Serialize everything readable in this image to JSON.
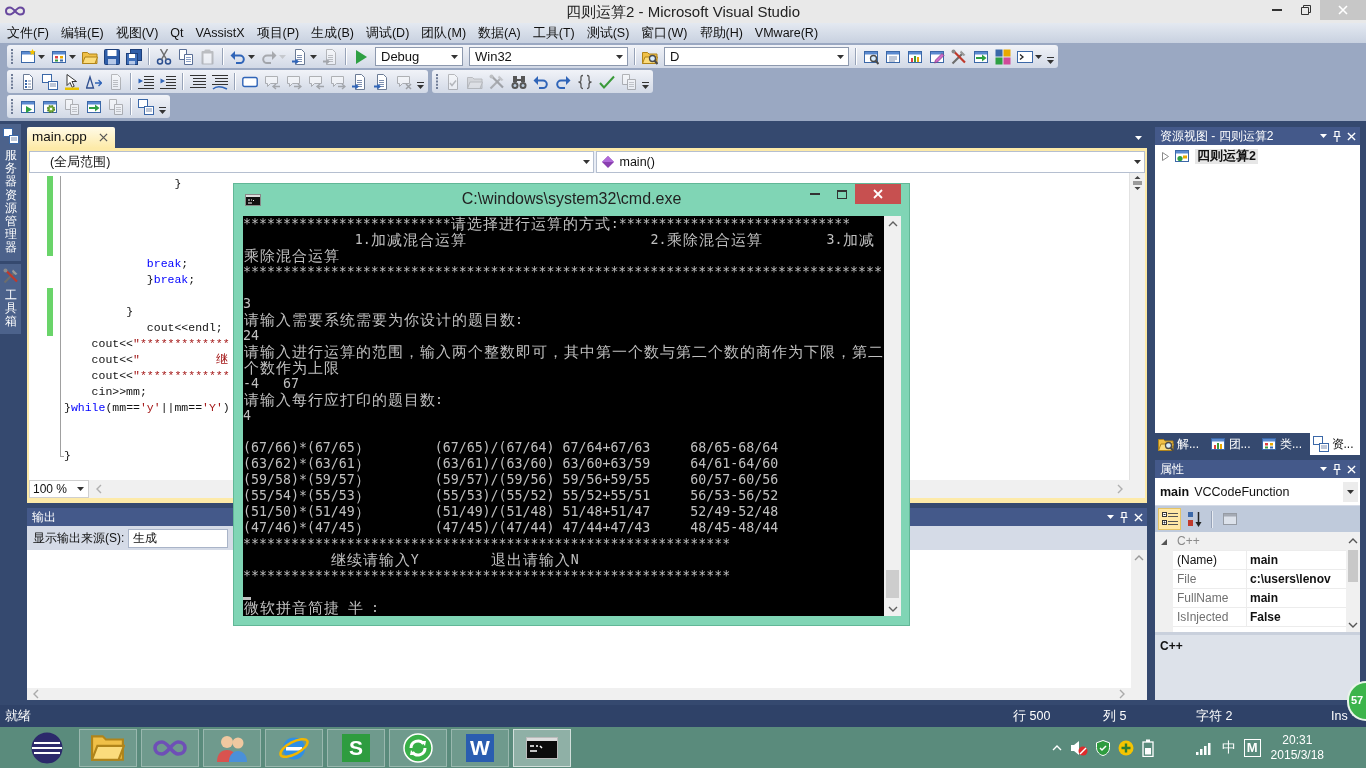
{
  "window": {
    "title": "四则运算2 - Microsoft Visual Studio"
  },
  "menu": [
    "文件(F)",
    "编辑(E)",
    "视图(V)",
    "Qt",
    "VAssistX",
    "项目(P)",
    "生成(B)",
    "调试(D)",
    "团队(M)",
    "数据(A)",
    "工具(T)",
    "测试(S)",
    "窗口(W)",
    "帮助(H)",
    "VMware(R)"
  ],
  "toolbar_rows": [
    {
      "toolbars": [
        {
          "items": [
            {
              "kind": "split",
              "disabled": false
            },
            {
              "kind": "split",
              "disabled": false
            },
            {
              "kind": "button",
              "disabled": false
            },
            {
              "kind": "button",
              "disabled": false
            },
            {
              "kind": "button",
              "disabled": false
            },
            {
              "kind": "separator"
            },
            {
              "kind": "button",
              "disabled": false
            },
            {
              "kind": "button",
              "disabled": false
            },
            {
              "kind": "button",
              "disabled": true
            },
            {
              "kind": "separator"
            },
            {
              "kind": "split",
              "disabled": false
            },
            {
              "kind": "split",
              "disabled": true
            },
            {
              "kind": "split",
              "disabled": false
            },
            {
              "kind": "button",
              "disabled": true
            },
            {
              "kind": "separator"
            },
            {
              "kind": "button",
              "disabled": false
            },
            {
              "kind": "combo",
              "value": "Debug"
            },
            {
              "kind": "combo",
              "value": "Win32"
            },
            {
              "kind": "separator"
            },
            {
              "kind": "button",
              "disabled": false
            },
            {
              "kind": "combo",
              "value": "D"
            },
            {
              "kind": "separator"
            },
            {
              "kind": "button",
              "disabled": false
            },
            {
              "kind": "button",
              "disabled": false
            },
            {
              "kind": "button",
              "disabled": false
            },
            {
              "kind": "button",
              "disabled": false
            },
            {
              "kind": "button",
              "disabled": false
            },
            {
              "kind": "button",
              "disabled": false
            },
            {
              "kind": "button",
              "disabled": false
            },
            {
              "kind": "split",
              "disabled": false
            },
            {
              "kind": "overflow"
            }
          ]
        }
      ]
    },
    {
      "toolbars": [
        {
          "items": [
            {
              "kind": "button",
              "disabled": false
            },
            {
              "kind": "button",
              "disabled": false
            },
            {
              "kind": "button",
              "disabled": false
            },
            {
              "kind": "button",
              "disabled": false
            },
            {
              "kind": "button",
              "disabled": true
            },
            {
              "kind": "separator"
            },
            {
              "kind": "button",
              "disabled": false
            },
            {
              "kind": "button",
              "disabled": false
            },
            {
              "kind": "separator"
            },
            {
              "kind": "button",
              "disabled": false
            },
            {
              "kind": "button",
              "disabled": false
            },
            {
              "kind": "separator"
            },
            {
              "kind": "button",
              "disabled": false
            },
            {
              "kind": "button",
              "disabled": true
            },
            {
              "kind": "button",
              "disabled": true
            },
            {
              "kind": "button",
              "disabled": true
            },
            {
              "kind": "button",
              "disabled": true
            },
            {
              "kind": "button",
              "disabled": false
            },
            {
              "kind": "button",
              "disabled": false
            },
            {
              "kind": "button",
              "disabled": true
            },
            {
              "kind": "overflow"
            }
          ]
        },
        {
          "items": [
            {
              "kind": "button",
              "disabled": true
            },
            {
              "kind": "button",
              "disabled": true
            },
            {
              "kind": "button",
              "disabled": true
            },
            {
              "kind": "button",
              "disabled": false
            },
            {
              "kind": "button",
              "disabled": false
            },
            {
              "kind": "button",
              "disabled": false
            },
            {
              "kind": "button",
              "disabled": false
            },
            {
              "kind": "button",
              "disabled": false
            },
            {
              "kind": "button",
              "disabled": true
            },
            {
              "kind": "overflow"
            }
          ]
        }
      ]
    },
    {
      "toolbars": [
        {
          "items": [
            {
              "kind": "button",
              "disabled": false
            },
            {
              "kind": "button",
              "disabled": false
            },
            {
              "kind": "button",
              "disabled": true
            },
            {
              "kind": "button",
              "disabled": false
            },
            {
              "kind": "button",
              "disabled": true
            },
            {
              "kind": "separator"
            },
            {
              "kind": "button",
              "disabled": false
            },
            {
              "kind": "overflow"
            }
          ]
        }
      ]
    }
  ],
  "side_tabs": [
    {
      "label": "服务器资源管理器"
    },
    {
      "label": "工具箱"
    }
  ],
  "editor": {
    "tabs": [
      {
        "label": "main.cpp",
        "selected": true
      }
    ],
    "scope": "(全局范围)",
    "member": "main()",
    "zoom": "100 %",
    "lines": [
      {
        "changed": true,
        "tokens": [
          {
            "kind": "plain",
            "text": "                }"
          }
        ]
      },
      {
        "changed": true
      },
      {
        "changed": true
      },
      {
        "changed": true
      },
      {
        "changed": true
      },
      {
        "changed": false,
        "tokens": [
          {
            "kind": "keyword",
            "text": "            break"
          },
          {
            "kind": "plain",
            "text": ";"
          }
        ]
      },
      {
        "changed": false,
        "tokens": [
          {
            "kind": "plain",
            "text": "            }"
          },
          {
            "kind": "keyword",
            "text": "break"
          },
          {
            "kind": "plain",
            "text": ";"
          }
        ]
      },
      {
        "changed": true
      },
      {
        "changed": true,
        "tokens": [
          {
            "kind": "plain",
            "text": "         }"
          }
        ]
      },
      {
        "changed": true,
        "tokens": [
          {
            "kind": "plain",
            "text": "            cout<<endl;"
          }
        ]
      },
      {
        "changed": false,
        "tokens": [
          {
            "kind": "plain",
            "text": "    cout<<"
          },
          {
            "kind": "string",
            "text": "\"*************"
          }
        ]
      },
      {
        "changed": false,
        "tokens": [
          {
            "kind": "plain",
            "text": "    cout<<"
          },
          {
            "kind": "string",
            "text": "\"           继"
          }
        ]
      },
      {
        "changed": false,
        "tokens": [
          {
            "kind": "plain",
            "text": "    cout<<"
          },
          {
            "kind": "string",
            "text": "\"*************"
          }
        ]
      },
      {
        "changed": false,
        "tokens": [
          {
            "kind": "plain",
            "text": "    cin>>mm;"
          }
        ]
      },
      {
        "changed": false,
        "tokens": [
          {
            "kind": "plain",
            "text": "}"
          },
          {
            "kind": "keyword",
            "text": "while"
          },
          {
            "kind": "plain",
            "text": "(mm=="
          },
          {
            "kind": "string",
            "text": "'y'"
          },
          {
            "kind": "plain",
            "text": "||mm=="
          },
          {
            "kind": "string",
            "text": "'Y'"
          },
          {
            "kind": "plain",
            "text": ")"
          }
        ]
      },
      {
        "changed": false
      },
      {
        "changed": false
      },
      {
        "changed": false,
        "tokens": [
          {
            "kind": "plain",
            "text": "}"
          }
        ]
      }
    ]
  },
  "output": {
    "title": "输出",
    "source_label": "显示输出来源(S):",
    "source": "生成"
  },
  "resource_view": {
    "title": "资源视图 - 四则运算2",
    "tree": [
      {
        "label": "四则运算2",
        "expanded": false,
        "selected": true
      }
    ],
    "tabs": [
      {
        "label": "解...",
        "selected": false
      },
      {
        "label": "团...",
        "selected": false
      },
      {
        "label": "类...",
        "selected": false
      },
      {
        "label": "资...",
        "selected": true
      }
    ]
  },
  "properties": {
    "title": "属性",
    "object_name": "main",
    "object_type": "VCCodeFunction",
    "view_buttons": [
      {
        "selected": true,
        "disabled": false
      },
      {
        "selected": false,
        "disabled": false
      }
    ],
    "pages_button": {
      "disabled": true
    },
    "category": {
      "label": "C++",
      "expanded": true
    },
    "rows": [
      {
        "name": "(Name)",
        "value": "main",
        "readonly": false
      },
      {
        "name": "File",
        "value": "c:\\users\\lenov",
        "readonly": true
      },
      {
        "name": "FullName",
        "value": "main",
        "readonly": true
      },
      {
        "name": "IsInjected",
        "value": "False",
        "readonly": true
      }
    ],
    "description": "C++"
  },
  "status_bar": {
    "message": "就绪",
    "line": "行 500",
    "column": "列 5",
    "char": "字符 2",
    "mode": "Ins"
  },
  "floating_ball": {
    "text": "57"
  },
  "console": {
    "title": "C:\\windows\\system32\\cmd.exe",
    "blocks": [
      {
        "lines": [
          "**************************请选择进行运算的方式:*****************************",
          [
            "              1.加减混合运算",
            "                       2.乘除混合运算",
            "        3.加减"
          ],
          "乘除混合运算",
          "********************************************************************************"
        ]
      },
      {
        "lines": [
          "3",
          "请输入需要系统需要为你设计的题目数:",
          "24",
          "请输入进行运算的范围，输入两个整数即可，其中第一个数与第二个数的商作为下限，第二",
          "个数作为上限",
          "-4   67",
          "请输入每行应打印的题目数:",
          "4"
        ]
      },
      {
        "lines": [
          "(67/66)*(67/65）        (67/65)/(67/64) 67/64+67/63     68/65-68/64",
          "(63/62)*(63/61）        (63/61)/(63/60) 63/60+63/59     64/61-64/60",
          "(59/58)*(59/57）        (59/57)/(59/56) 59/56+59/55     60/57-60/56",
          "(55/54)*(55/53）        (55/53)/(55/52) 55/52+55/51     56/53-56/52",
          "(51/50)*(51/49）        (51/49)/(51/48) 51/48+51/47     52/49-52/48",
          "(47/46)*(47/45）        (47/45)/(47/44) 47/44+47/43     48/45-48/44",
          "*************************************************************",
          "           继续请输入Y         退出请输入N",
          "*************************************************************"
        ]
      }
    ],
    "ime_status": "微软拼音简捷 半 :"
  },
  "taskbar": {
    "apps": [
      {
        "running": false,
        "selected": false
      },
      {
        "running": true,
        "selected": false
      },
      {
        "running": true,
        "selected": false
      },
      {
        "running": true,
        "selected": false
      },
      {
        "running": true,
        "selected": false
      },
      {
        "glyph": "S",
        "color": "#2e9c3f",
        "running": true,
        "selected": false
      },
      {
        "running": true,
        "selected": false
      },
      {
        "glyph": "W",
        "color": "#2a5db0",
        "running": true,
        "selected": false
      },
      {
        "running": true,
        "selected": true
      }
    ],
    "tray": {
      "language": "中",
      "input_mode": "M",
      "time": "20:31",
      "date": "2015/3/18"
    }
  }
}
